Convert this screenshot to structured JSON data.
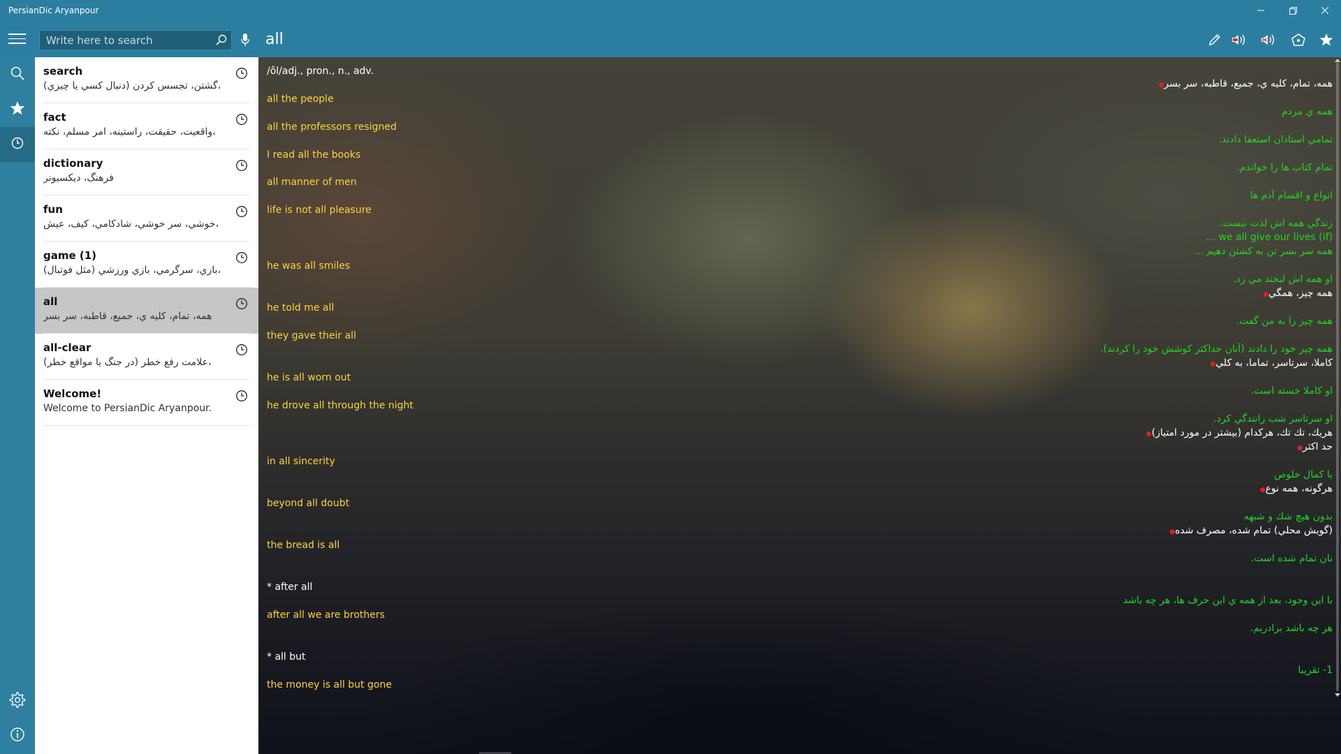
{
  "app": {
    "title": "PersianDic Aryanpour"
  },
  "search": {
    "placeholder": "Write here to search",
    "value": ""
  },
  "current_word": "all",
  "history": [
    {
      "word": "search",
      "def": "(دنبال كسي يا چيزي) گشتن، تجسس كردن،",
      "selected": false
    },
    {
      "word": "fact",
      "def": "واقعيت، حقيقت، راستينه، امر مسلم، نكته،",
      "selected": false
    },
    {
      "word": "dictionary",
      "def": "فرهنگ، ديكسيونر",
      "selected": false
    },
    {
      "word": "fun",
      "def": "خوشي، سر خوشي، شادكامي، كيف، عيش،",
      "selected": false
    },
    {
      "word": "game (1)",
      "def": "بازي، سرگرمي، بازي ورزشي (مثل فوتبال)،",
      "selected": false
    },
    {
      "word": "all",
      "def": "همه، تمام، كليه ي، جميع، قاطبه، سر بسر",
      "selected": true
    },
    {
      "word": "all-clear",
      "def": "(در جنگ يا مواقع خطر) علامت رفع خطر،",
      "selected": false
    },
    {
      "word": "Welcome!",
      "def": "Welcome to PersianDic Aryanpour.",
      "selected": false
    }
  ],
  "entry_en": [
    {
      "text": "/ôl/adj., pron., n., adv.",
      "color": "white"
    },
    {
      "text": "all the people",
      "color": "yellow"
    },
    {
      "text": "all the professors resigned",
      "color": "yellow"
    },
    {
      "text": "I read all the books",
      "color": "yellow"
    },
    {
      "text": "all manner of men",
      "color": "yellow"
    },
    {
      "text": "life is not all pleasure",
      "color": "yellow"
    },
    {
      "text": "he was all smiles",
      "color": "yellow"
    },
    {
      "text": "he told me all",
      "color": "yellow"
    },
    {
      "text": "they gave their all",
      "color": "yellow"
    },
    {
      "text": "he is all worn out",
      "color": "yellow"
    },
    {
      "text": "he drove all through the night",
      "color": "yellow"
    },
    {
      "text": "in all sincerity",
      "color": "yellow"
    },
    {
      "text": "beyond all doubt",
      "color": "yellow"
    },
    {
      "text": "the bread is all",
      "color": "yellow"
    },
    {
      "text": "* after all",
      "color": "white"
    },
    {
      "text": "after all we are brothers",
      "color": "yellow"
    },
    {
      "text": "* all but",
      "color": "white"
    },
    {
      "text": "the money is all but gone",
      "color": "yellow"
    }
  ],
  "entry_fa": [
    {
      "text": "همه، تمام، كليه ي، جميع، قاطبه، سر بسر",
      "color": "white",
      "bullet": true
    },
    {
      "text": "همه ي مردم",
      "color": "green",
      "bullet": false
    },
    {
      "text": "تمامي استادان استعفا دادند.",
      "color": "green",
      "bullet": false
    },
    {
      "text": "تمام كتاب ها را خواندم.",
      "color": "green",
      "bullet": false
    },
    {
      "text": "انواع و اقسام آدم ها",
      "color": "green",
      "bullet": false
    },
    {
      "text": "زندگي همه اش لذت نيست.",
      "color": "green",
      "bullet": false
    },
    {
      "text": "(if) we all give our lives ...",
      "color": "green",
      "bullet": false
    },
    {
      "text": "همه سر بسر تن به كشتن دهيم ...",
      "color": "green",
      "bullet": false
    },
    {
      "text": "او همه اش لبخند مي زد.",
      "color": "green",
      "bullet": false
    },
    {
      "text": "همه چيز، همگي",
      "color": "white",
      "bullet": true
    },
    {
      "text": "همه چيز را به من گفت.",
      "color": "green",
      "bullet": false
    },
    {
      "text": "همه چيز خود را دادند (آنان حداكثر كوشش خود را كردند).",
      "color": "green",
      "bullet": false
    },
    {
      "text": "كاملا، سرتاسر، تماما، به كلي",
      "color": "white",
      "bullet": true
    },
    {
      "text": "او كاملا خسته است.",
      "color": "green",
      "bullet": false
    },
    {
      "text": "او سرتاسر شب رانندگي كرد.",
      "color": "green",
      "bullet": false
    },
    {
      "text": "هريك، تك تك، هركدام (بيشتر در مورد امتياز)",
      "color": "white",
      "bullet": true
    },
    {
      "text": "حد اكثر",
      "color": "white",
      "bullet": true
    },
    {
      "text": "با كمال خلوص",
      "color": "green",
      "bullet": false
    },
    {
      "text": "هرگونه، همه نوع",
      "color": "white",
      "bullet": true
    },
    {
      "text": "بدون هيچ شك و شبهه",
      "color": "green",
      "bullet": false
    },
    {
      "text": "(گويش محلي) تمام شده، مصرف شده",
      "color": "white",
      "bullet": true
    },
    {
      "text": "نان تمام شده است.",
      "color": "green",
      "bullet": false
    },
    {
      "text": "با اين وجود، بعد از همه ي اين حرف ها، هر چه باشد",
      "color": "green",
      "bullet": false
    },
    {
      "text": "هر چه باشد برادريم.",
      "color": "green",
      "bullet": false
    },
    {
      "text": "1- تقريبا",
      "color": "green",
      "bullet": false
    }
  ],
  "colors": {
    "accent": "#2c7ea0",
    "yellow": "#ffd23c",
    "green": "#22d422",
    "bullet": "#e02020"
  },
  "icons": {
    "toolbar": [
      "pencil-icon",
      "speaker-us-icon",
      "speaker-uk-icon",
      "share-icon",
      "star-icon"
    ],
    "rail": [
      "search-icon",
      "star-icon",
      "history-icon",
      "settings-icon",
      "info-icon"
    ]
  }
}
